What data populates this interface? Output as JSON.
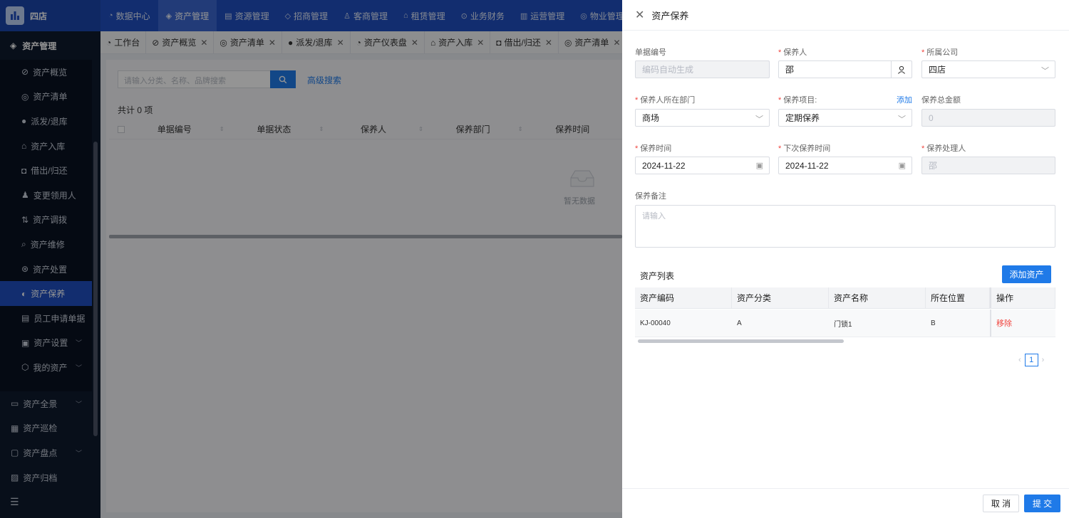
{
  "app": {
    "store": "四店"
  },
  "topnav": [
    {
      "label": "数据中心",
      "icon": "dashboard-icon",
      "active": false
    },
    {
      "label": "资产管理",
      "icon": "cube-icon",
      "active": true
    },
    {
      "label": "资源管理",
      "icon": "document-icon",
      "active": false
    },
    {
      "label": "招商管理",
      "icon": "tag-icon",
      "active": false
    },
    {
      "label": "客商管理",
      "icon": "users-icon",
      "active": false
    },
    {
      "label": "租赁管理",
      "icon": "home-icon",
      "active": false
    },
    {
      "label": "业务财务",
      "icon": "money-icon",
      "active": false
    },
    {
      "label": "运营管理",
      "icon": "chart-icon",
      "active": false
    },
    {
      "label": "物业管理",
      "icon": "building-icon",
      "active": false
    }
  ],
  "sidebar": {
    "header": "资产管理",
    "sub_items": [
      {
        "label": "资产概览"
      },
      {
        "label": "资产清单"
      },
      {
        "label": "派发/退库"
      },
      {
        "label": "资产入库"
      },
      {
        "label": "借出/归还"
      },
      {
        "label": "变更领用人"
      },
      {
        "label": "资产调拨"
      },
      {
        "label": "资产维修"
      },
      {
        "label": "资产处置"
      },
      {
        "label": "资产保养",
        "active": true
      },
      {
        "label": "员工申请单据"
      },
      {
        "label": "资产设置",
        "chevron": true
      },
      {
        "label": "我的资产",
        "chevron": true
      }
    ],
    "main_items": [
      {
        "label": "资产全景",
        "chevron": true
      },
      {
        "label": "资产巡检"
      },
      {
        "label": "资产盘点",
        "chevron": true
      },
      {
        "label": "资产归档"
      }
    ]
  },
  "tabs": [
    {
      "label": "工作台",
      "closable": false
    },
    {
      "label": "资产概览",
      "closable": true
    },
    {
      "label": "资产清单",
      "closable": true
    },
    {
      "label": "派发/退库",
      "closable": true
    },
    {
      "label": "资产仪表盘",
      "closable": true
    },
    {
      "label": "资产入库",
      "closable": true
    },
    {
      "label": "借出/归还",
      "closable": true
    },
    {
      "label": "资产清单",
      "closable": true
    }
  ],
  "list": {
    "search_placeholder": "请输入分类、名称、品牌搜索",
    "advanced_search": "高级搜索",
    "total": "共计 0 项",
    "columns": [
      "单据编号",
      "单据状态",
      "保养人",
      "保养部门",
      "保养时间"
    ],
    "empty": "暂无数据"
  },
  "drawer": {
    "title": "资产保养",
    "fields": {
      "doc_no": {
        "label": "单据编号",
        "placeholder": "编码自动生成"
      },
      "maintainer": {
        "label": "保养人",
        "value": "邵"
      },
      "company": {
        "label": "所属公司",
        "value": "四店"
      },
      "department": {
        "label": "保养人所在部门",
        "value": "商场"
      },
      "project": {
        "label": "保养项目:",
        "value": "定期保养",
        "add": "添加"
      },
      "total_amount": {
        "label": "保养总金额",
        "value": "0"
      },
      "maint_time": {
        "label": "保养时间",
        "value": "2024-11-22"
      },
      "next_time": {
        "label": "下次保养时间",
        "value": "2024-11-22"
      },
      "handler": {
        "label": "保养处理人",
        "value": "邵"
      },
      "remark": {
        "label": "保养备注",
        "placeholder": "请输入"
      }
    },
    "asset_list": {
      "title": "资产列表",
      "add_button": "添加资产",
      "columns": [
        "资产编码",
        "资产分类",
        "资产名称",
        "所在位置",
        "操作"
      ],
      "rows": [
        {
          "code": "KJ-00040",
          "category": "A",
          "name": "门锁1",
          "location": "B",
          "action": "移除"
        }
      ],
      "page": "1"
    },
    "footer": {
      "cancel": "取 消",
      "submit": "提 交"
    }
  }
}
